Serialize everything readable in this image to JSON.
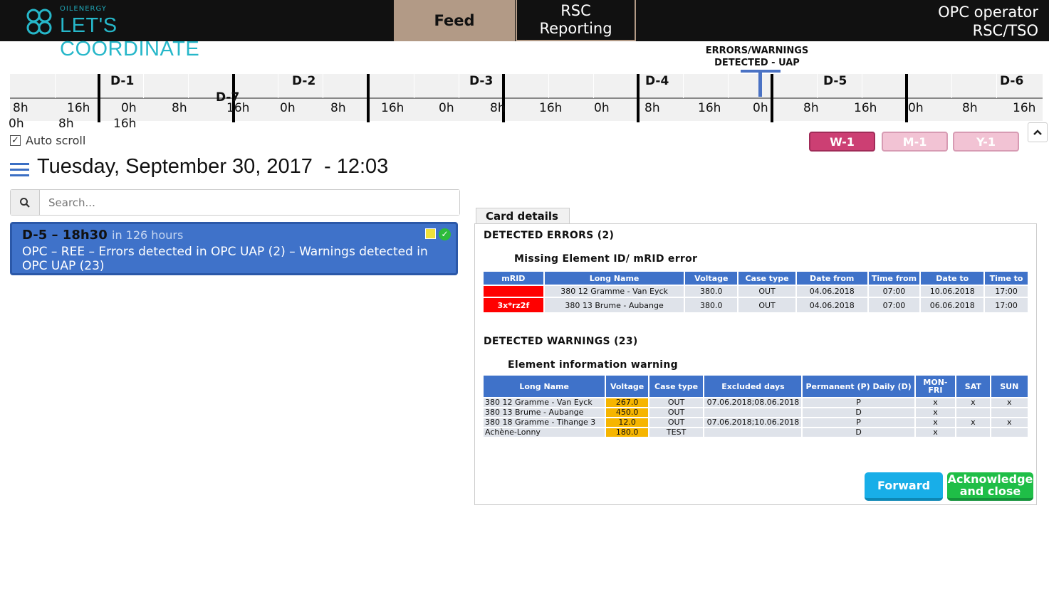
{
  "header": {
    "logo_sub": "OILENERGY",
    "logo_main": "LET'S COORDINATE",
    "tabs": [
      {
        "label": "Feed"
      },
      {
        "label": "RSC\nReporting"
      }
    ],
    "user": {
      "line1": "OPC operator",
      "line2": "RSC/TSO"
    }
  },
  "timeline": {
    "banner": "ERRORS/WARNINGS\nDETECTED - UAP",
    "days": [
      "D-1",
      "D-7",
      "D-2",
      "D-3",
      "D-4",
      "D-5",
      "D-6"
    ],
    "hours": [
      "8h",
      "16h",
      "0h",
      "8h",
      "16h",
      "0h",
      "8h",
      "16h",
      "0h",
      "8h",
      "16h",
      "0h",
      "8h",
      "16h",
      "0h",
      "8h",
      "16h",
      "0h",
      "8h",
      "16h"
    ],
    "hours_row2": [
      "0h",
      "8h",
      "16h"
    ],
    "auto_scroll_label": "Auto scroll",
    "auto_scroll_checked": true,
    "range_buttons": [
      "W-1",
      "M-1",
      "Y-1"
    ]
  },
  "feed": {
    "date_title": "Tuesday, September 30, 2017  - 12:03",
    "search_placeholder": "Search...",
    "card": {
      "title": "D-5 – 18h30",
      "when": "in 126 hours",
      "body": "OPC – REE – Errors detected in OPC UAP (2) – Warnings detected in OPC UAP (23)"
    }
  },
  "details": {
    "tab_label": "Card details",
    "errors_title": "DETECTED ERRORS (2)",
    "errors_subtitle": "Missing Element ID/ mRID error",
    "errors_headers": [
      "mRID",
      "Long Name",
      "Voltage",
      "Case type",
      "Date from",
      "Time from",
      "Date to",
      "Time to"
    ],
    "errors_rows": [
      [
        "",
        "380 12 Gramme - Van Eyck",
        "380.0",
        "OUT",
        "04.06.2018",
        "07:00",
        "10.06.2018",
        "17:00"
      ],
      [
        "3x*rz2f",
        "380 13 Brume - Aubange",
        "380.0",
        "OUT",
        "04.06.2018",
        "07:00",
        "06.06.2018",
        "17:00"
      ]
    ],
    "warnings_title": "DETECTED WARNINGS (23)",
    "warnings_subtitle": "Element information warning",
    "warnings_headers": [
      "Long Name",
      "Voltage",
      "Case type",
      "Excluded days",
      "Permanent (P) Daily (D)",
      "MON-\nFRI",
      "SAT",
      "SUN"
    ],
    "warnings_rows": [
      [
        "380 12 Gramme - Van Eyck",
        "267.0",
        "OUT",
        "07.06.2018;08.06.2018",
        "P",
        "x",
        "x",
        "x"
      ],
      [
        "380 13 Brume - Aubange",
        "450.0",
        "OUT",
        "",
        "D",
        "x",
        "",
        ""
      ],
      [
        "380 18 Gramme - Tihange 3",
        "12.0",
        "OUT",
        "07.06.2018;10.06.2018",
        "P",
        "x",
        "x",
        "x"
      ],
      [
        "Achène-Lonny",
        "180.0",
        "TEST",
        "",
        "D",
        "x",
        "",
        ""
      ]
    ],
    "forward_label": "Forward",
    "ack_label": "Acknowledge and close"
  },
  "colors": {
    "accent": "#3f72c9",
    "error": "#ff0000",
    "warning": "#f6b500",
    "feed_tab": "#b29a86"
  }
}
